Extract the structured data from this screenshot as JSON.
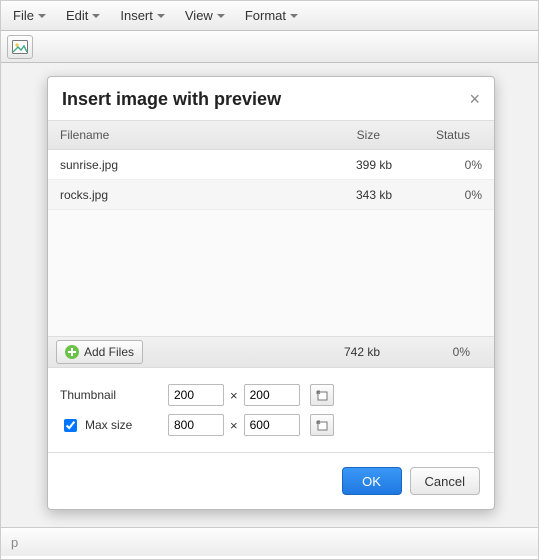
{
  "menubar": {
    "items": [
      "File",
      "Edit",
      "Insert",
      "View",
      "Format"
    ]
  },
  "toolbar": {
    "image_btn_title": "Insert image"
  },
  "statusbar": {
    "path": "p"
  },
  "dialog": {
    "title": "Insert image with preview",
    "columns": {
      "filename": "Filename",
      "size": "Size",
      "status": "Status"
    },
    "files": [
      {
        "name": "sunrise.jpg",
        "size": "399 kb",
        "progress": "0%"
      },
      {
        "name": "rocks.jpg",
        "size": "343 kb",
        "progress": "0%"
      }
    ],
    "totals": {
      "size": "742 kb",
      "progress": "0%"
    },
    "add_files_label": "Add Files",
    "options": {
      "thumbnail_label": "Thumbnail",
      "thumbnail_w": "200",
      "thumbnail_h": "200",
      "maxsize_label": "Max size",
      "maxsize_checked": true,
      "maxsize_w": "800",
      "maxsize_h": "600",
      "times": "×"
    },
    "buttons": {
      "ok": "OK",
      "cancel": "Cancel"
    }
  }
}
